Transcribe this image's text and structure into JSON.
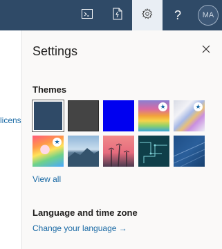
{
  "topbar": {
    "help_label": "?",
    "avatar_initials": "MA",
    "background": "#2f4a67"
  },
  "left_fragment": {
    "text": "licens"
  },
  "settings": {
    "title": "Settings",
    "themes_heading": "Themes",
    "themes": [
      {
        "name": "dark-blue",
        "selected": true,
        "star": false
      },
      {
        "name": "dark-gray",
        "selected": false,
        "star": false
      },
      {
        "name": "blue",
        "selected": false,
        "star": false
      },
      {
        "name": "rainbow-waves",
        "selected": false,
        "star": true
      },
      {
        "name": "prism",
        "selected": false,
        "star": true
      },
      {
        "name": "unicorn",
        "selected": false,
        "star": true
      },
      {
        "name": "mountains",
        "selected": false,
        "star": false
      },
      {
        "name": "palm-sunset",
        "selected": false,
        "star": false
      },
      {
        "name": "circuit",
        "selected": false,
        "star": false
      },
      {
        "name": "innovation",
        "selected": false,
        "star": false
      }
    ],
    "view_all": "View all",
    "language_heading": "Language and time zone",
    "change_language": "Change your language →"
  }
}
